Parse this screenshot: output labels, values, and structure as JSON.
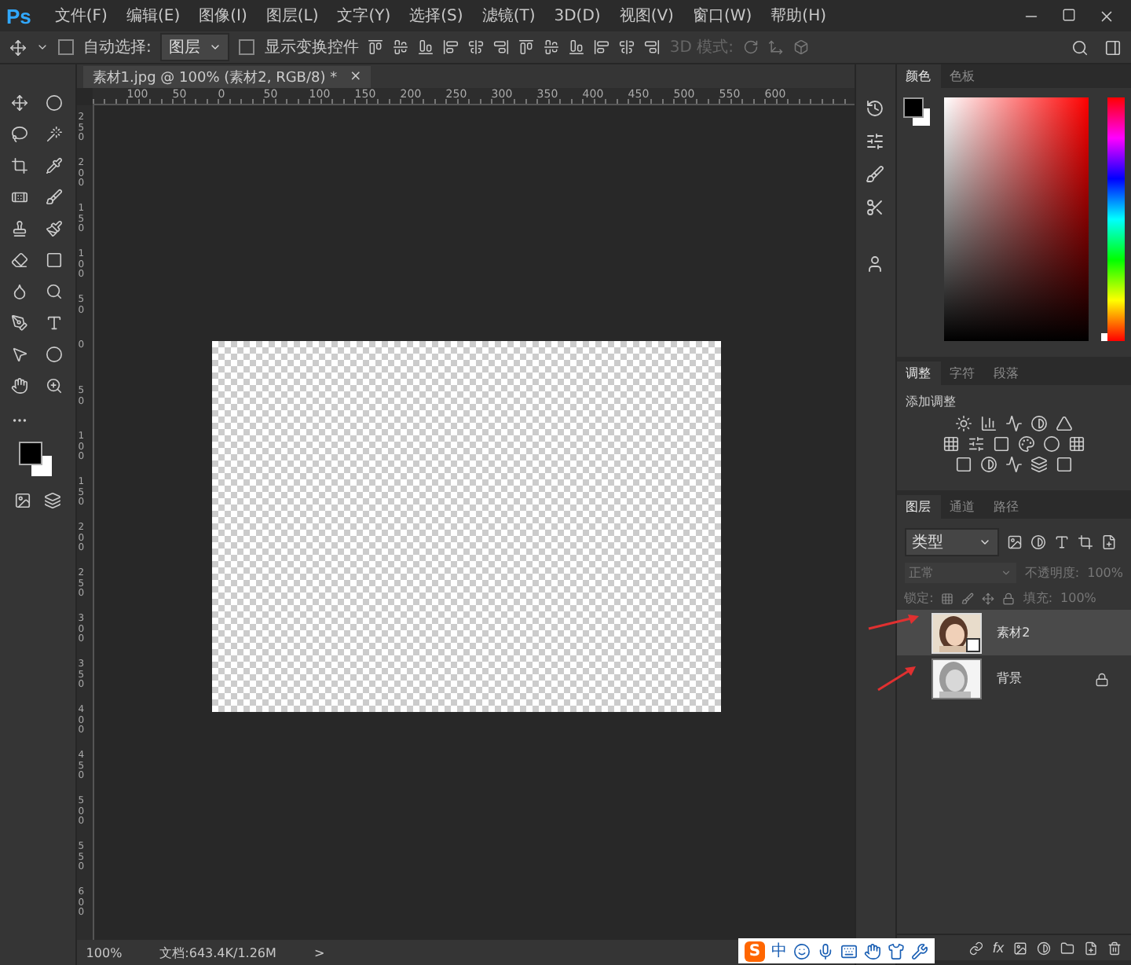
{
  "app": {
    "logo": "Ps"
  },
  "menu": [
    "文件(F)",
    "编辑(E)",
    "图像(I)",
    "图层(L)",
    "文字(Y)",
    "选择(S)",
    "滤镜(T)",
    "3D(D)",
    "视图(V)",
    "窗口(W)",
    "帮助(H)"
  ],
  "options": {
    "auto_select": {
      "label": "自动选择:",
      "checked": false
    },
    "target": "图层",
    "transform": {
      "label": "显示变换控件",
      "checked": false
    },
    "mode_3d": "3D 模式:"
  },
  "document": {
    "tab": "素材1.jpg @ 100% (素材2, RGB/8) *",
    "close": "×"
  },
  "ruler": {
    "horizontal": [
      "100",
      "50",
      "0",
      "50",
      "100",
      "150",
      "200",
      "250",
      "300",
      "350",
      "400",
      "450",
      "500",
      "550",
      "600"
    ],
    "vertical": [
      "250",
      "200",
      "150",
      "100",
      "50",
      "0",
      "50",
      "100",
      "150",
      "200",
      "250",
      "300",
      "350",
      "400",
      "450",
      "500",
      "550",
      "600"
    ]
  },
  "status": {
    "zoom": "100%",
    "doc": "文档:643.4K/1.26M",
    "arrow": ">"
  },
  "color_panel": {
    "tabs": [
      {
        "label": "颜色",
        "selected": true
      },
      {
        "label": "色板",
        "selected": false
      }
    ],
    "hue": {
      "level": 0
    }
  },
  "adjust_panel": {
    "tabs": [
      {
        "label": "调整",
        "selected": true
      },
      {
        "label": "字符",
        "selected": false
      },
      {
        "label": "段落",
        "selected": false
      }
    ],
    "title": "添加调整"
  },
  "layers": {
    "tabs": [
      {
        "label": "图层",
        "selected": true
      },
      {
        "label": "通道",
        "selected": false
      },
      {
        "label": "路径",
        "selected": false
      }
    ],
    "filter": "类型",
    "blend": "正常",
    "opacity_label": "不透明度:",
    "opacity": "100%",
    "lock_label": "锁定:",
    "fill_label": "填充:",
    "fill": "100%",
    "items": [
      {
        "name": "素材2",
        "selected": true,
        "locked": false,
        "kind": "smart"
      },
      {
        "name": "背景",
        "selected": false,
        "locked": true,
        "kind": "plain"
      }
    ],
    "fx": "fx"
  },
  "ime": {
    "logo": "S",
    "mode": "中"
  }
}
